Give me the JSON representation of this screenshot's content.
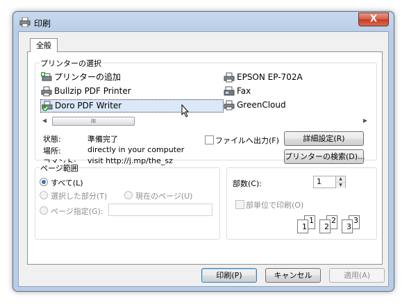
{
  "window": {
    "title": "印刷",
    "close_label": "X"
  },
  "tabs": [
    {
      "label": "全般"
    }
  ],
  "printer_select": {
    "group_title": "プリンターの選択",
    "printers": [
      {
        "name": "プリンターの追加",
        "icon": "add-printer-icon"
      },
      {
        "name": "Bullzip PDF Printer",
        "icon": "printer-icon"
      },
      {
        "name": "Doro PDF Writer",
        "icon": "default-printer-icon",
        "selected": true
      },
      {
        "name": "EPSON EP-702A",
        "icon": "printer-icon"
      },
      {
        "name": "Fax",
        "icon": "fax-icon"
      },
      {
        "name": "GreenCloud",
        "icon": "printer-icon"
      }
    ],
    "scroll_thumb": "III",
    "status_label": "状態:",
    "status_value": "準備完了",
    "location_label": "場所:",
    "location_value": "directly in your computer",
    "comment_label": "コメント:",
    "comment_value": "visit http://j.mp/the_sz",
    "print_to_file_label": "ファイルへ出力(F)",
    "print_to_file_checked": false,
    "preferences_button": "詳細設定(R)",
    "find_printer_button": "プリンターの検索(D)..."
  },
  "page_range": {
    "group_title": "ページ範囲",
    "all_label": "すべて(L)",
    "selection_label": "選択した部分(T)",
    "current_page_label": "現在のページ(U)",
    "pages_label": "ページ指定(G):",
    "pages_value": ""
  },
  "copies": {
    "count_label": "部数(C):",
    "count_value": "1",
    "collate_label": "部単位で印刷(O)",
    "collate_checked": false,
    "collate_pages": [
      "1",
      "1",
      "2",
      "2",
      "3",
      "3"
    ]
  },
  "footer": {
    "print_button": "印刷(P)",
    "cancel_button": "キャンセル",
    "apply_button": "適用(A)"
  },
  "colors": {
    "selection": "#dbe8f7",
    "title_gradient": "#c8d9ee",
    "close_button": "#c43b23"
  }
}
